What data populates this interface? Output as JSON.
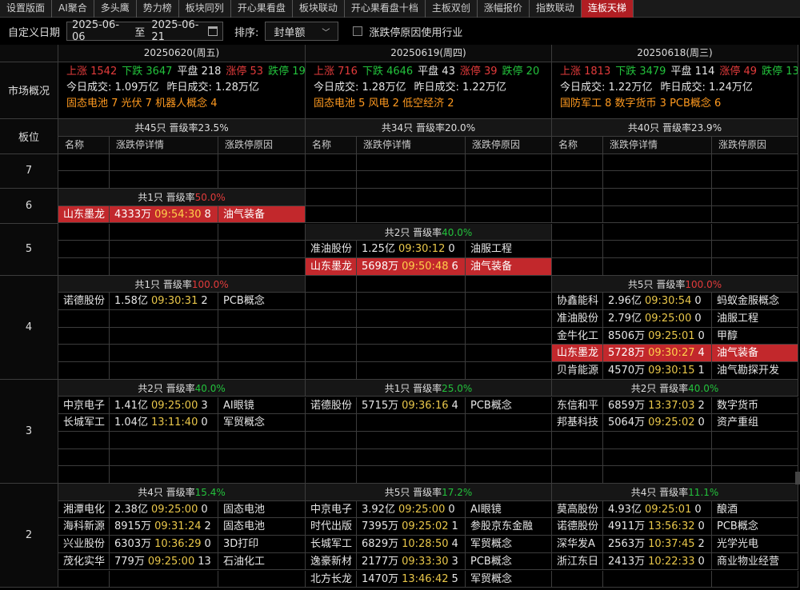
{
  "tabs": [
    "设置版面",
    "AI聚合",
    "多头鹰",
    "势力榜",
    "板块同列",
    "开心果看盘",
    "板块联动",
    "开心果看盘十档",
    "主板双创",
    "涨幅报价",
    "指数联动",
    "连板天梯"
  ],
  "active_tab": 11,
  "toolbar": {
    "date_label": "自定义日期",
    "date_from": "2025-06-06",
    "date_sep": "至",
    "date_to": "2025-06-21",
    "sort_label": "排序:",
    "sort_value": "封单额",
    "checkbox_label": "涨跌停原因使用行业"
  },
  "labels": {
    "market": "市场概况",
    "board": "板位",
    "col_name": "名称",
    "col_detail": "涨跌停详情",
    "col_reason": "涨跌停原因",
    "promo": "晋级率"
  },
  "days": [
    {
      "date": "20250620(周五)",
      "up": "上涨 1542",
      "down": "下跌 3647",
      "flat": "平盘 218",
      "lu": "涨停 53",
      "ld": "跌停 19",
      "today": "今日成交: 1.09万亿",
      "yest": "昨日成交: 1.28万亿",
      "hot": "固态电池 7  光伏 7  机器人概念 4",
      "summary": "共45只  晋级率23.5%"
    },
    {
      "date": "20250619(周四)",
      "up": "上涨 716",
      "down": "下跌 4646",
      "flat": "平盘 43",
      "lu": "涨停 39",
      "ld": "跌停 20",
      "today": "今日成交: 1.28万亿",
      "yest": "昨日成交: 1.22万亿",
      "hot": "固态电池 5  风电 2  低空经济 2",
      "summary": "共34只  晋级率20.0%"
    },
    {
      "date": "20250618(周三)",
      "up": "上涨 1813",
      "down": "下跌 3479",
      "flat": "平盘 114",
      "lu": "涨停 49",
      "ld": "跌停 13",
      "today": "今日成交: 1.22万亿",
      "yest": "昨日成交: 1.24万亿",
      "hot": "国防军工 8  数字货币 3  PCB概念 6",
      "summary": "共40只  晋级率23.9%"
    }
  ],
  "boards": [
    {
      "level": "7",
      "groups": [
        null,
        null,
        null
      ]
    },
    {
      "level": "6",
      "groups": [
        {
          "count": "共1只",
          "rate": "50.0%",
          "rate_color": "red",
          "stocks": [
            {
              "name": "山东墨龙",
              "amount": "4333万",
              "time": "09:54:30",
              "num": "8",
              "reason": "油气装备",
              "hl": true
            }
          ]
        },
        null,
        null
      ]
    },
    {
      "level": "5",
      "groups": [
        null,
        {
          "count": "共2只",
          "rate": "40.0%",
          "rate_color": "green",
          "stocks": [
            {
              "name": "准油股份",
              "amount": "1.25亿",
              "time": "09:30:12",
              "num": "0",
              "reason": "油服工程"
            },
            {
              "name": "山东墨龙",
              "amount": "5698万",
              "time": "09:50:48",
              "num": "6",
              "reason": "油气装备",
              "hl": true
            }
          ]
        },
        null
      ]
    },
    {
      "level": "4",
      "groups": [
        {
          "count": "共1只",
          "rate": "100.0%",
          "rate_color": "red",
          "stocks": [
            {
              "name": "诺德股份",
              "amount": "1.58亿",
              "time": "09:30:31",
              "num": "2",
              "reason": "PCB概念"
            }
          ]
        },
        null,
        {
          "count": "共5只",
          "rate": "100.0%",
          "rate_color": "red",
          "stocks": [
            {
              "name": "协鑫能科",
              "amount": "2.96亿",
              "time": "09:30:54",
              "num": "0",
              "reason": "蚂蚁金服概念"
            },
            {
              "name": "准油股份",
              "amount": "2.79亿",
              "time": "09:25:00",
              "num": "0",
              "reason": "油服工程"
            },
            {
              "name": "金牛化工",
              "amount": "8506万",
              "time": "09:25:01",
              "num": "0",
              "reason": "甲醇"
            },
            {
              "name": "山东墨龙",
              "amount": "5728万",
              "time": "09:30:27",
              "num": "4",
              "reason": "油气装备",
              "hl": true
            },
            {
              "name": "贝肯能源",
              "amount": "4570万",
              "time": "09:30:15",
              "num": "1",
              "reason": "油气勘探开发"
            }
          ]
        }
      ]
    },
    {
      "level": "3",
      "groups": [
        {
          "count": "共2只",
          "rate": "40.0%",
          "rate_color": "green",
          "stocks": [
            {
              "name": "中京电子",
              "amount": "1.41亿",
              "time": "09:25:00",
              "num": "3",
              "reason": "AI眼镜"
            },
            {
              "name": "长城军工",
              "amount": "1.04亿",
              "time": "13:11:40",
              "num": "0",
              "reason": "军贸概念"
            }
          ]
        },
        {
          "count": "共1只",
          "rate": "25.0%",
          "rate_color": "green",
          "stocks": [
            {
              "name": "诺德股份",
              "amount": "5715万",
              "time": "09:36:16",
              "num": "4",
              "reason": "PCB概念"
            }
          ]
        },
        {
          "count": "共2只",
          "rate": "40.0%",
          "rate_color": "green",
          "stocks": [
            {
              "name": "东信和平",
              "amount": "6859万",
              "time": "13:37:03",
              "num": "2",
              "reason": "数字货币"
            },
            {
              "name": "邦基科技",
              "amount": "5064万",
              "time": "09:25:02",
              "num": "0",
              "reason": "资产重组"
            }
          ]
        }
      ]
    },
    {
      "level": "2",
      "groups": [
        {
          "count": "共4只",
          "rate": "15.4%",
          "rate_color": "green",
          "stocks": [
            {
              "name": "湘潭电化",
              "amount": "2.38亿",
              "time": "09:25:00",
              "num": "0",
              "reason": "固态电池"
            },
            {
              "name": "海科新源",
              "amount": "8915万",
              "time": "09:31:24",
              "num": "2",
              "reason": "固态电池"
            },
            {
              "name": "兴业股份",
              "amount": "6303万",
              "time": "10:36:29",
              "num": "0",
              "reason": "3D打印"
            },
            {
              "name": "茂化实华",
              "amount": "779万",
              "time": "09:25:00",
              "num": "13",
              "reason": "石油化工"
            }
          ]
        },
        {
          "count": "共5只",
          "rate": "17.2%",
          "rate_color": "green",
          "stocks": [
            {
              "name": "中京电子",
              "amount": "3.92亿",
              "time": "09:25:00",
              "num": "0",
              "reason": "AI眼镜"
            },
            {
              "name": "时代出版",
              "amount": "7395万",
              "time": "09:25:02",
              "num": "1",
              "reason": "参股京东金融"
            },
            {
              "name": "长城军工",
              "amount": "6829万",
              "time": "10:28:50",
              "num": "4",
              "reason": "军贸概念"
            },
            {
              "name": "逸豪新材",
              "amount": "2177万",
              "time": "09:33:30",
              "num": "3",
              "reason": "PCB概念"
            },
            {
              "name": "北方长龙",
              "amount": "1470万",
              "time": "13:46:42",
              "num": "5",
              "reason": "军贸概念"
            }
          ]
        },
        {
          "count": "共4只",
          "rate": "11.1%",
          "rate_color": "green",
          "stocks": [
            {
              "name": "莫高股份",
              "amount": "4.93亿",
              "time": "09:25:01",
              "num": "0",
              "reason": "酿酒"
            },
            {
              "name": "诺德股份",
              "amount": "4911万",
              "time": "13:56:32",
              "num": "0",
              "reason": "PCB概念"
            },
            {
              "name": "深华发A",
              "amount": "2563万",
              "time": "10:37:45",
              "num": "2",
              "reason": "光学光电"
            },
            {
              "name": "浙江东日",
              "amount": "2413万",
              "time": "10:22:33",
              "num": "0",
              "reason": "商业物业经营"
            }
          ]
        }
      ]
    }
  ]
}
